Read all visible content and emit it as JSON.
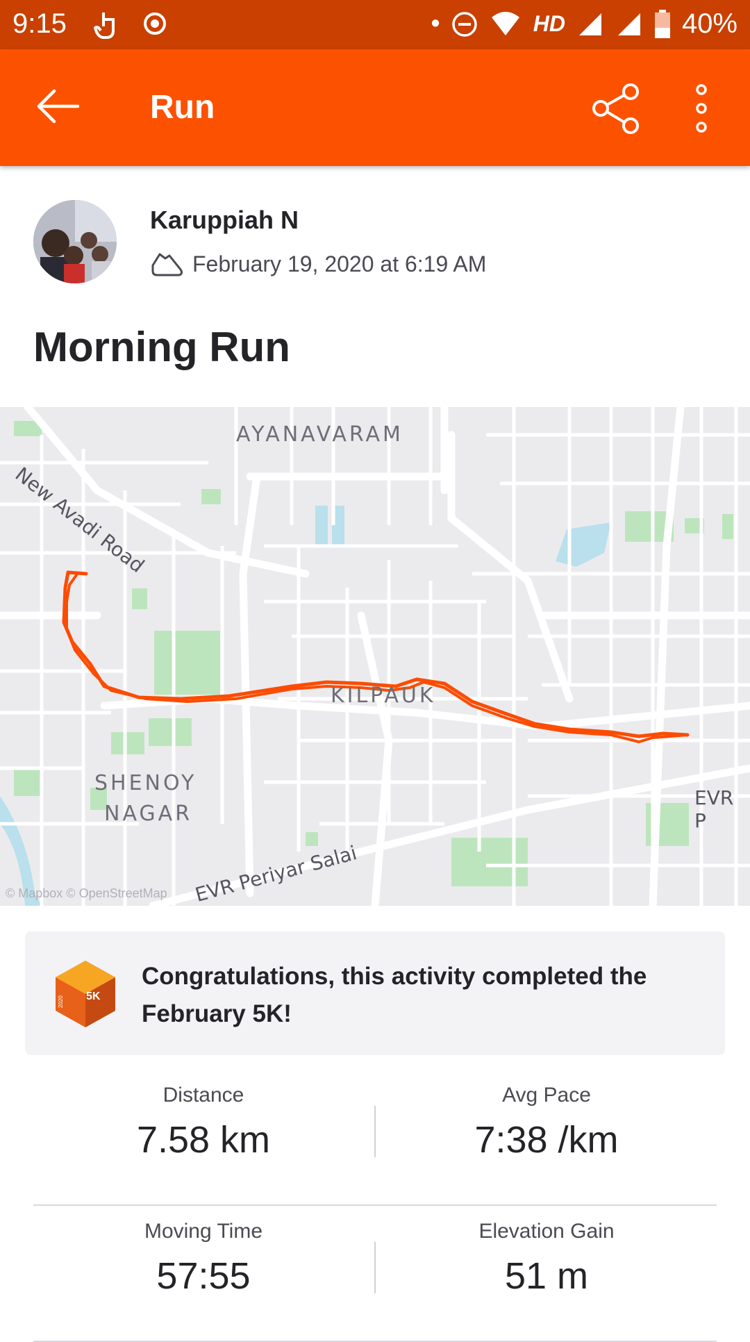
{
  "status_bar": {
    "time": "9:15",
    "network_label": "HD",
    "battery": "40%"
  },
  "app_bar": {
    "title": "Run",
    "icons": [
      "back-arrow-icon",
      "share-icon",
      "more-vert-icon"
    ]
  },
  "header": {
    "athlete_name": "Karuppiah N",
    "activity_icon": "shoe-icon",
    "datetime": "February 19, 2020 at 6:19 AM"
  },
  "activity_title": "Morning Run",
  "map": {
    "area_labels": [
      "AYANAVARAM",
      "KILPAUK",
      "SHENOY",
      "NAGAR"
    ],
    "road_labels": [
      "New Avadi Road",
      "EVR Periyar Salai",
      "EVR P"
    ],
    "attribution": "© Mapbox © OpenStreetMap",
    "route_color": "#fc4c02"
  },
  "achievement": {
    "badge_text": "5K",
    "badge_year": "2020",
    "message": "Congratulations, this activity completed the February 5K!"
  },
  "stats": [
    {
      "label": "Distance",
      "value": "7.58 km"
    },
    {
      "label": "Avg Pace",
      "value": "7:38 /km"
    },
    {
      "label": "Moving Time",
      "value": "57:55"
    },
    {
      "label": "Elevation Gain",
      "value": "51 m"
    }
  ],
  "colors": {
    "brand": "#fc5200",
    "status_bar": "#c94000"
  }
}
